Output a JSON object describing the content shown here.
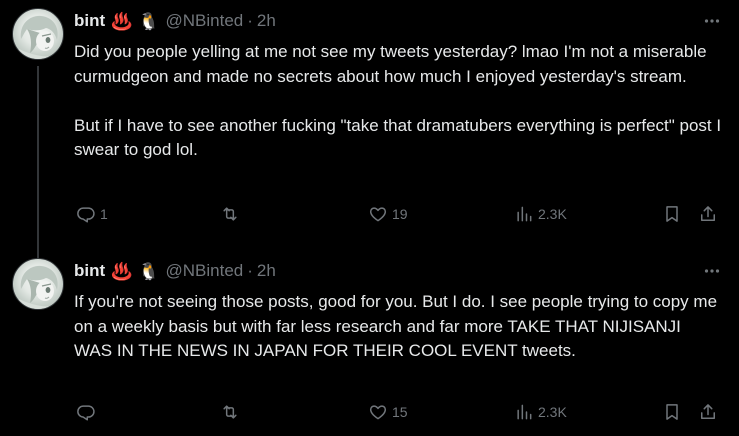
{
  "colors": {
    "background": "#000000",
    "primary_text": "#e7e9ea",
    "secondary_text": "#71767b",
    "thread_line": "#333639"
  },
  "tweets": [
    {
      "display_name": "bint",
      "emoji_1": "♨️",
      "emoji_2": "🐧",
      "handle": "@NBinted",
      "dot": "·",
      "time": "2h",
      "more": "···",
      "text": "Did you people yelling at me not see my tweets yesterday? lmao I'm not a miserable curmudgeon and made no secrets about how much I enjoyed yesterday's stream.\n\nBut if I have to see another fucking \"take that dramatubers everything is perfect\" post I swear to god lol.",
      "reply_count": "1",
      "retweet_count": "",
      "like_count": "19",
      "view_count": "2.3K"
    },
    {
      "display_name": "bint",
      "emoji_1": "♨️",
      "emoji_2": "🐧",
      "handle": "@NBinted",
      "dot": "·",
      "time": "2h",
      "more": "···",
      "text": "If you're not seeing those posts, good for you. But I do. I see people trying to copy me on a weekly basis but with far less research and far more TAKE THAT NIJISANJI WAS IN THE NEWS IN JAPAN FOR THEIR COOL EVENT tweets.",
      "reply_count": "",
      "retweet_count": "",
      "like_count": "15",
      "view_count": "2.3K"
    }
  ],
  "icons": {
    "avatar": "anime-avatar-icon",
    "more": "more-dots-icon",
    "reply": "reply-icon",
    "retweet": "retweet-icon",
    "like": "heart-icon",
    "views": "views-chart-icon",
    "bookmark": "bookmark-icon",
    "share": "share-icon"
  }
}
